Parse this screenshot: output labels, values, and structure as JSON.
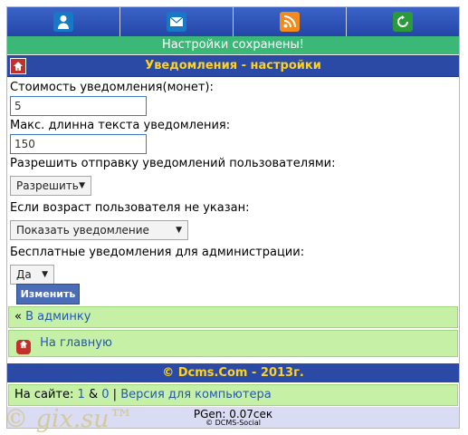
{
  "top_nav": [
    {
      "icon": "user-icon",
      "color": "#1778c5"
    },
    {
      "icon": "mail-icon",
      "color": "#1778c5"
    },
    {
      "icon": "rss-icon",
      "color": "#f18b1e"
    },
    {
      "icon": "refresh-icon",
      "color": "#2b9a3b"
    }
  ],
  "notice": "Настройки сохранены!",
  "header": {
    "title": "Уведомления - настройки"
  },
  "form": {
    "cost_label": "Стоимость уведомления(монет):",
    "cost_value": "5",
    "maxlen_label": "Макс. длинна текста уведомления:",
    "maxlen_value": "150",
    "allow_label": "Разрешить отправку уведомлений пользователями:",
    "allow_value": "Разрешить",
    "age_label": "Если возраст пользователя не указан:",
    "age_value": "Показать уведомление",
    "free_label": "Бесплатные уведомления для администрации:",
    "free_value": "Да",
    "submit": "Изменить"
  },
  "links": {
    "admin_prefix": "«",
    "admin": "В админку",
    "home": "На главную"
  },
  "footer": {
    "copyright": "© Dcms.Com - 2013г.",
    "online_prefix": "На сайте:",
    "online_users": "1",
    "amp": "&",
    "online_guests": "0",
    "sep": "|",
    "desktop": "Версия для компьютера",
    "pgen": "PGen: 0.07сек",
    "dcms": "© DCMS-Social"
  },
  "watermark": "© gix.su™",
  "colors": {
    "accent": "#2a4aa6",
    "title_text": "#ffd21f",
    "success": "#3bb877",
    "link_row": "#c7f0a7"
  }
}
